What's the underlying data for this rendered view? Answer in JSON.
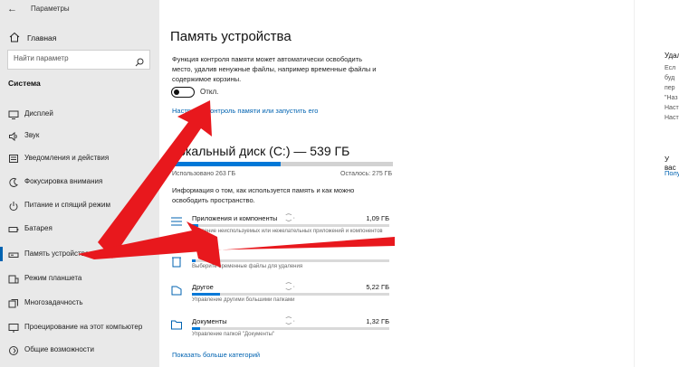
{
  "window": {
    "title": "Параметры"
  },
  "sidebar": {
    "home": "Главная",
    "search_placeholder": "Найти параметр",
    "section": "Система",
    "items": [
      {
        "label": "Дисплей",
        "icon": "display-icon"
      },
      {
        "label": "Звук",
        "icon": "sound-icon"
      },
      {
        "label": "Уведомления и действия",
        "icon": "notifications-icon"
      },
      {
        "label": "Фокусировка внимания",
        "icon": "focus-assist-icon"
      },
      {
        "label": "Питание и спящий режим",
        "icon": "power-icon"
      },
      {
        "label": "Батарея",
        "icon": "battery-icon"
      },
      {
        "label": "Память устройства",
        "icon": "storage-icon",
        "active": true
      },
      {
        "label": "Режим планшета",
        "icon": "tablet-mode-icon"
      },
      {
        "label": "Многозадачность",
        "icon": "multitasking-icon"
      },
      {
        "label": "Проецирование на этот компьютер",
        "icon": "projecting-icon"
      },
      {
        "label": "Общие возможности",
        "icon": "shared-experiences-icon"
      }
    ]
  },
  "main": {
    "title": "Память устройства",
    "description": "Функция контроля памяти может автоматически освободить место, удалив ненужные файлы, например временные файлы и содержимое корзины.",
    "toggle_label": "Откл.",
    "toggle_on": false,
    "configure_link": "Настроить контроль памяти или запустить его",
    "disk_title": "Локальный диск (C:) — 539 ГБ",
    "used": "Использовано 263 ГБ",
    "free": "Осталось: 275 ГБ",
    "used_fraction": 0.49,
    "info": "Информация о том, как используется память и как можно освободить пространство.",
    "categories": [
      {
        "name": "Приложения и компоненты",
        "size": "1,09 ГБ",
        "sub": "Удаление неиспользуемых или нежелательных приложений и компонентов",
        "fraction": 0.03,
        "icon": "apps-icon"
      },
      {
        "name": "",
        "size": "",
        "sub": "Выберите временные файлы для удаления",
        "fraction": 0.02,
        "icon": "temp-files-icon"
      },
      {
        "name": "Другое",
        "size": "5,22 ГБ",
        "sub": "Управление другими большими папками",
        "fraction": 0.14,
        "icon": "other-icon"
      },
      {
        "name": "Документы",
        "size": "1,32 ГБ",
        "sub": "Управление папкой \"Документы\"",
        "fraction": 0.04,
        "icon": "documents-icon"
      }
    ],
    "spinner": "⁐ ·",
    "more_link": "Показать больше категорий"
  },
  "right": {
    "heading1": "Удал",
    "lines": [
      "Есл",
      "буд",
      "пер",
      "\"Наз",
      "Наст",
      "Наст"
    ],
    "heading2": "У вас",
    "link": "Полу"
  }
}
